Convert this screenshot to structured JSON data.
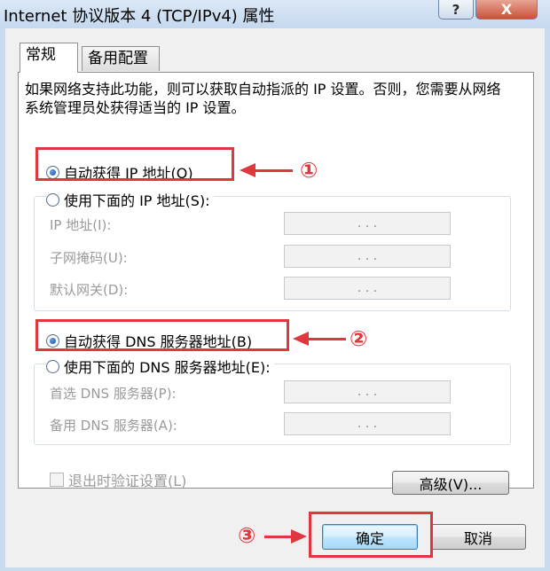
{
  "window": {
    "title": "Internet 协议版本 4 (TCP/IPv4) 属性",
    "help_label": "?",
    "close_label": "X"
  },
  "tabs": [
    {
      "label": "常规",
      "active": true
    },
    {
      "label": "备用配置",
      "active": false
    }
  ],
  "description": "如果网络支持此功能，则可以获取自动指派的 IP 设置。否则，您需要从网络系统管理员处获得适当的 IP 设置。",
  "ip_section": {
    "auto_label": "自动获得 IP 地址(O)",
    "auto_selected": true,
    "manual_label": "使用下面的 IP 地址(S):",
    "fields": [
      {
        "label": "IP 地址(I):",
        "value": ".   .   ."
      },
      {
        "label": "子网掩码(U):",
        "value": ".   .   ."
      },
      {
        "label": "默认网关(D):",
        "value": ".   .   ."
      }
    ]
  },
  "dns_section": {
    "auto_label": "自动获得 DNS 服务器地址(B)",
    "auto_selected": true,
    "manual_label": "使用下面的 DNS 服务器地址(E):",
    "fields": [
      {
        "label": "首选 DNS 服务器(P):",
        "value": ".   .   ."
      },
      {
        "label": "备用 DNS 服务器(A):",
        "value": ".   .   ."
      }
    ]
  },
  "validate_checkbox": {
    "label": "退出时验证设置(L)",
    "checked": false
  },
  "buttons": {
    "advanced": "高级(V)...",
    "ok": "确定",
    "cancel": "取消"
  },
  "annotations": {
    "step1": "①",
    "step2": "②",
    "step3": "③",
    "color": "#e0363d"
  }
}
